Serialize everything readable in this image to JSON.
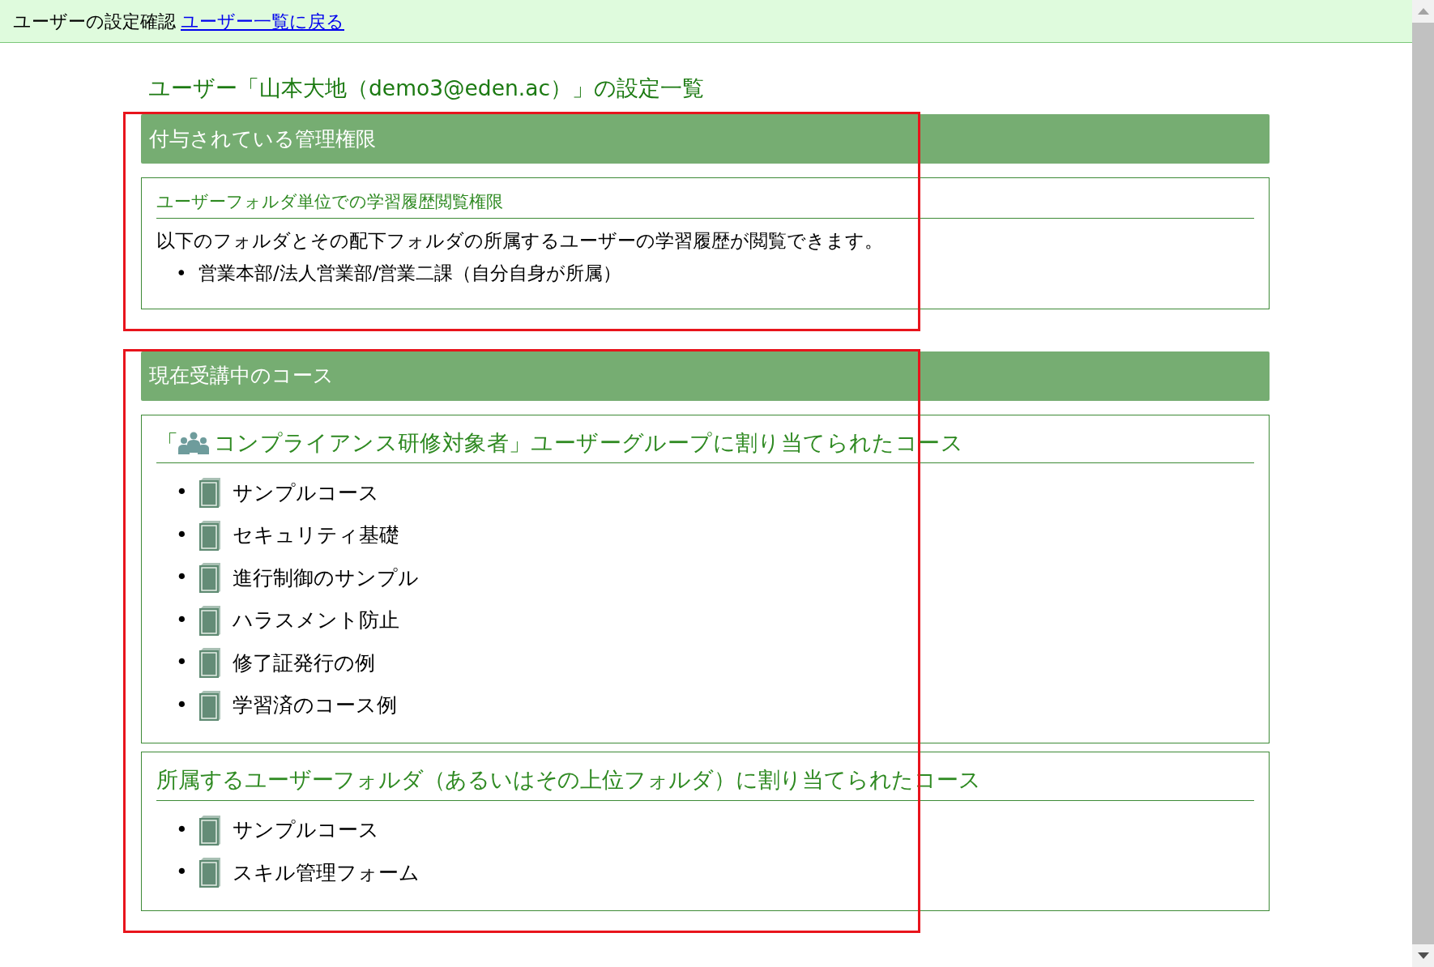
{
  "header": {
    "title": "ユーザーの設定確認",
    "link": "ユーザー一覧に戻る"
  },
  "page_title": "ユーザー「山本大地（demo3@eden.ac）」の設定一覧",
  "sections": [
    {
      "title": "付与されている管理権限",
      "highlighted": true,
      "boxes": [
        {
          "kind": "permission",
          "heading": "ユーザーフォルダ単位での学習履歴閲覧権限",
          "text": "以下のフォルダとその配下フォルダの所属するユーザーの学習履歴が閲覧できます。",
          "marker": "•",
          "items": [
            "営業本部/法人営業部/営業二課（自分自身が所属）"
          ]
        }
      ]
    },
    {
      "title": "現在受講中のコース",
      "highlighted": true,
      "boxes": [
        {
          "kind": "group",
          "heading_before": "「",
          "heading": "コンプライアンス研修対象者」ユーザーグループに割り当てられたコース",
          "marker": "•",
          "items": [
            "サンプルコース",
            "セキュリティ基礎",
            "進行制御のサンプル",
            "ハラスメント防止",
            "修了証発行の例",
            "学習済のコース例"
          ]
        },
        {
          "kind": "folder",
          "heading": "所属するユーザーフォルダ（あるいはその上位フォルダ）に割り当てられたコース",
          "marker": "•",
          "items": [
            "サンプルコース",
            "スキル管理フォーム"
          ]
        }
      ]
    }
  ]
}
